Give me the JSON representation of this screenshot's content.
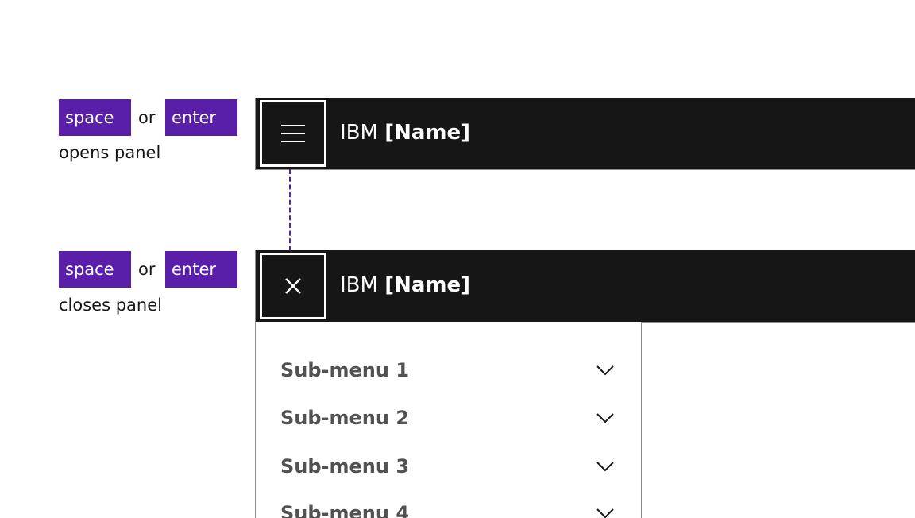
{
  "colors": {
    "key_bg": "#5a1fa8",
    "header_bg": "#161616",
    "submenu_text": "#525252"
  },
  "open_hint": {
    "key1": "space",
    "or": "or",
    "key2": "enter",
    "caption": "opens panel"
  },
  "close_hint": {
    "key1": "space",
    "or": "or",
    "key2": "enter",
    "caption": "closes panel"
  },
  "header_collapsed": {
    "icon": "hamburger-menu-icon",
    "brand_prefix": "IBM",
    "brand_name": "[Name]"
  },
  "header_expanded": {
    "icon": "close-icon",
    "brand_prefix": "IBM",
    "brand_name": "[Name]"
  },
  "side_nav": {
    "items": [
      {
        "label": "Sub-menu 1",
        "icon": "chevron-down-icon"
      },
      {
        "label": "Sub-menu 2",
        "icon": "chevron-down-icon"
      },
      {
        "label": "Sub-menu 3",
        "icon": "chevron-down-icon"
      },
      {
        "label": "Sub-menu 4",
        "icon": "chevron-down-icon"
      }
    ]
  }
}
